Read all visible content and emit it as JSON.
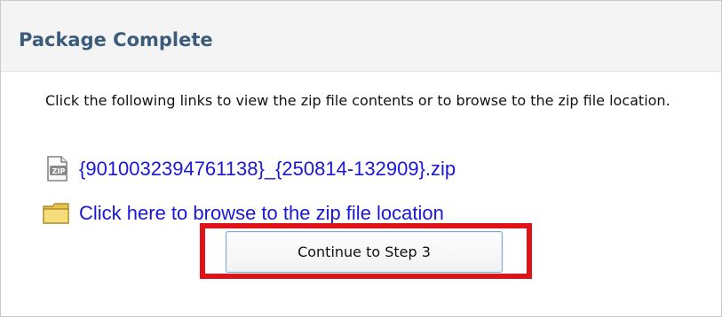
{
  "dialog": {
    "title": "Package Complete",
    "instructions": "Click the following links to view the zip file contents or to browse to the zip file location.",
    "zip_link": {
      "label": "{9010032394761138}_{250814-132909}.zip",
      "icon": "zip-file-icon"
    },
    "folder_link": {
      "label": "Click here to browse to the zip file location",
      "icon": "folder-icon"
    },
    "continue_button": "Continue to Step 3"
  },
  "colors": {
    "title": "#3c5c7b",
    "link": "#1a17d6",
    "highlight": "#e01318"
  }
}
